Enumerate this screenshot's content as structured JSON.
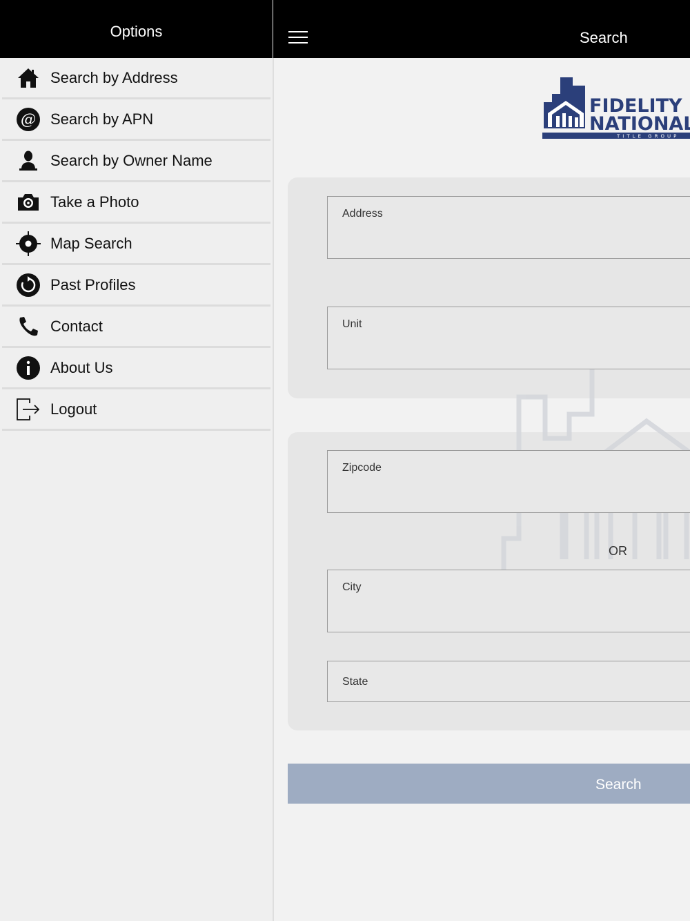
{
  "sidebar": {
    "title": "Options",
    "items": [
      {
        "label": "Search by Address",
        "icon": "home-icon"
      },
      {
        "label": "Search by APN",
        "icon": "at-icon"
      },
      {
        "label": "Search by Owner Name",
        "icon": "person-icon"
      },
      {
        "label": "Take a Photo",
        "icon": "camera-icon"
      },
      {
        "label": "Map Search",
        "icon": "target-icon"
      },
      {
        "label": "Past Profiles",
        "icon": "history-icon"
      },
      {
        "label": "Contact",
        "icon": "phone-icon"
      },
      {
        "label": "About Us",
        "icon": "info-icon"
      },
      {
        "label": "Logout",
        "icon": "logout-icon"
      }
    ]
  },
  "header": {
    "title": "Search",
    "menu_icon": "hamburger-icon"
  },
  "logo": {
    "line1": "FIDELITY",
    "line2": "NATIONAL",
    "line3": "TITLE GROUP",
    "color": "#2b3f7a"
  },
  "form": {
    "address_placeholder": "Address",
    "unit_placeholder": "Unit",
    "zipcode_placeholder": "Zipcode",
    "or_text": "OR",
    "city_placeholder": "City",
    "state_placeholder": "State",
    "search_label": "Search"
  },
  "colors": {
    "button_bg": "#9eacc2",
    "header_bg": "#000000"
  }
}
